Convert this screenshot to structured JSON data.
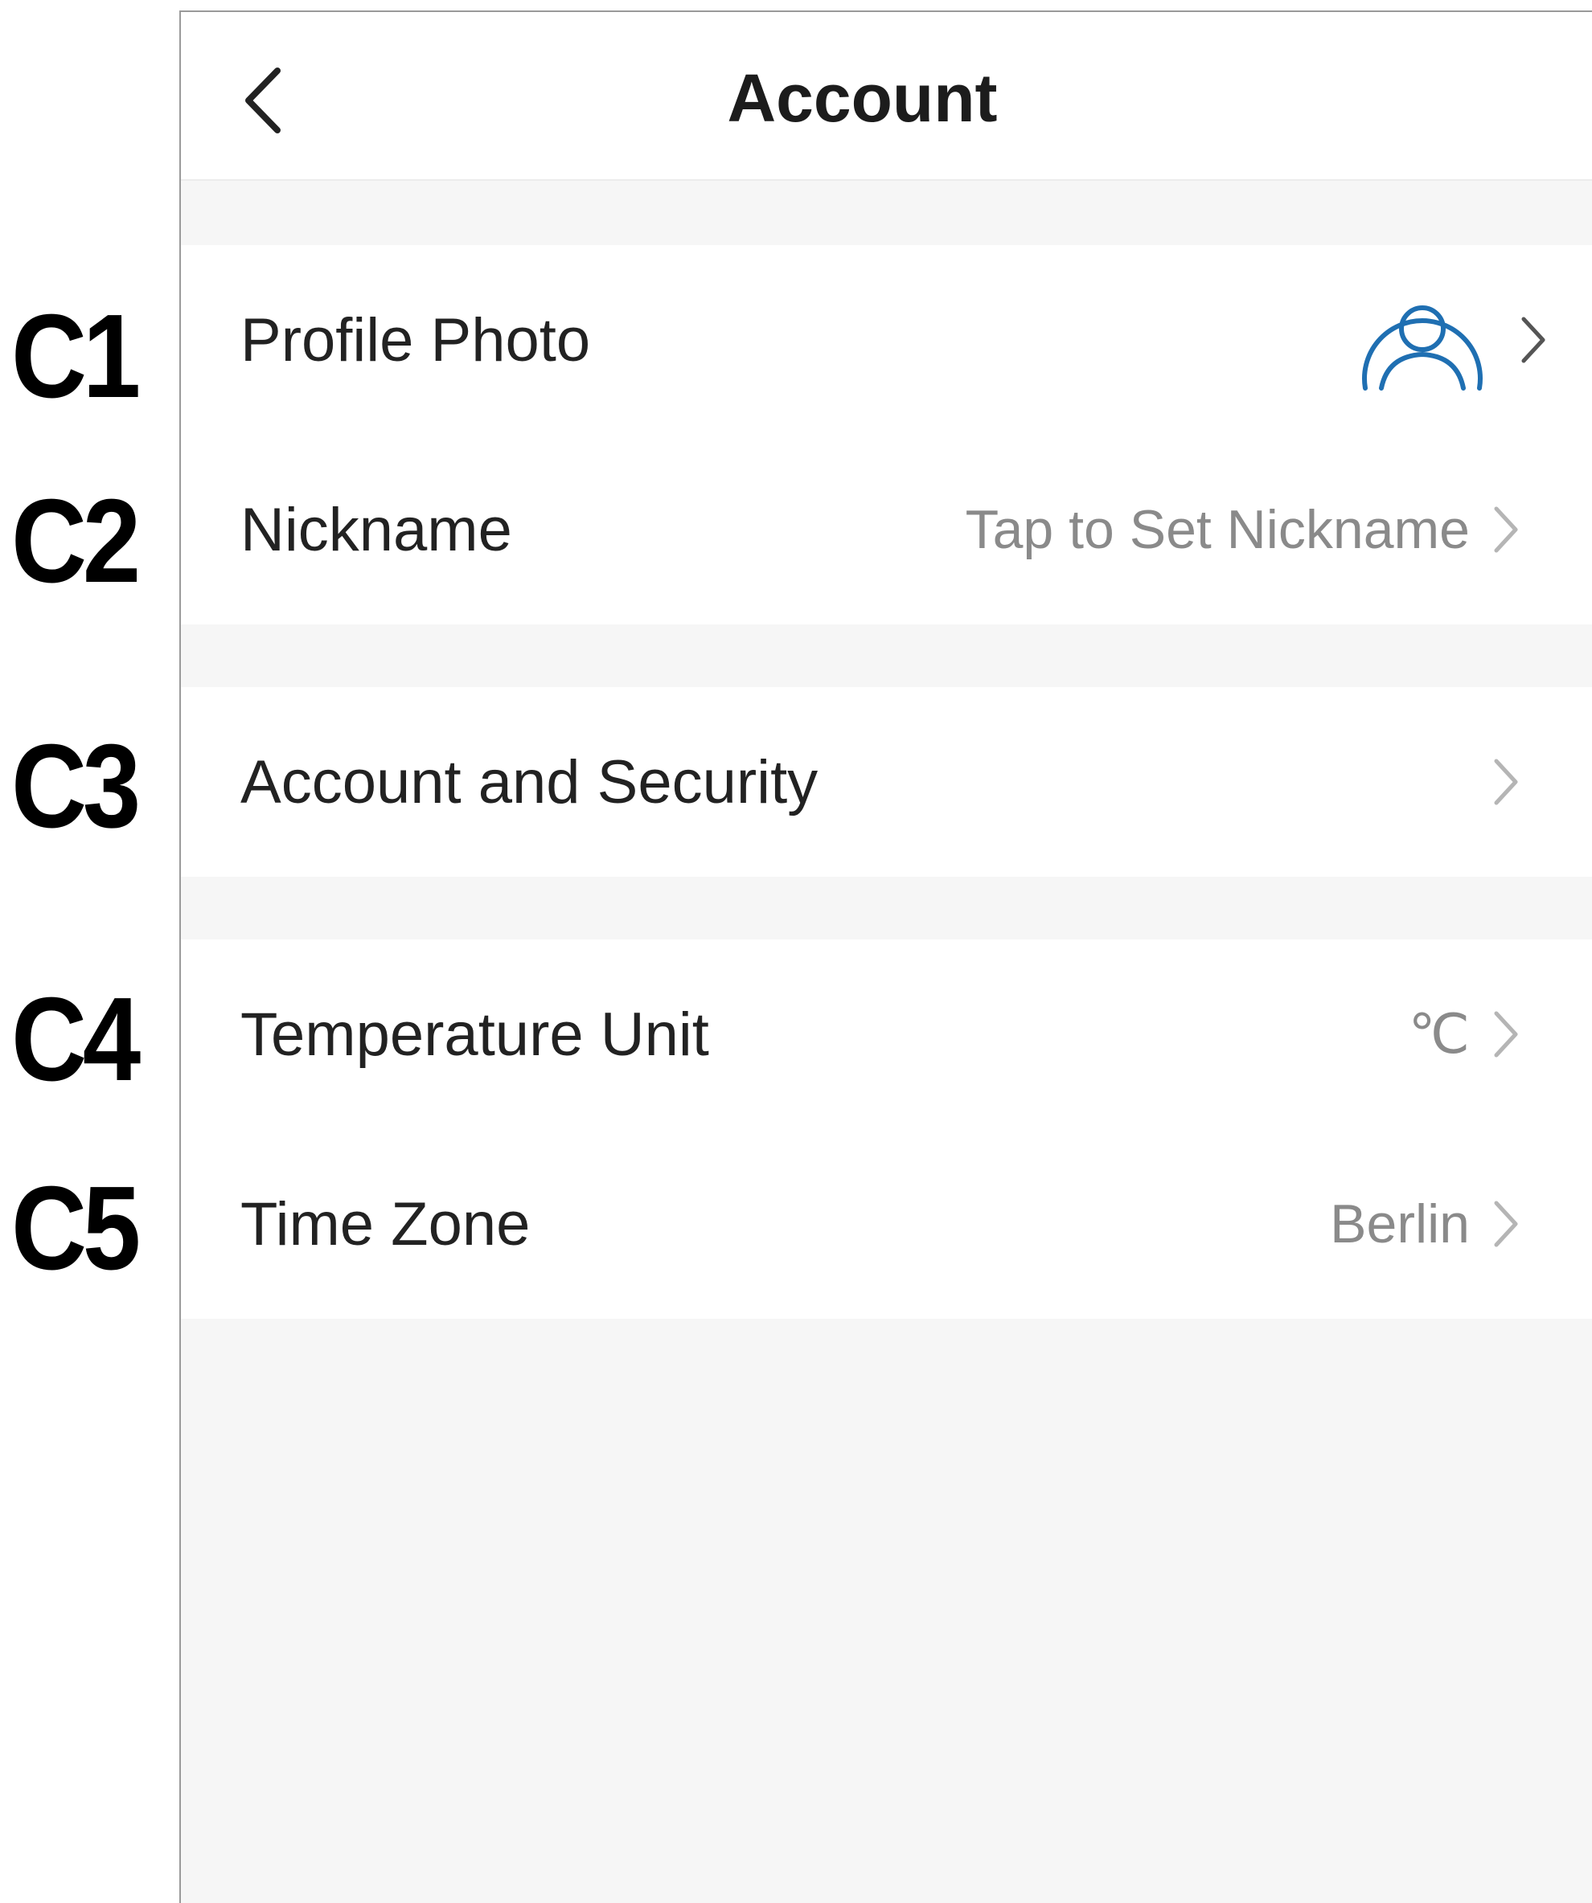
{
  "callouts": {
    "c1": "C1",
    "c2": "C2",
    "c3": "C3",
    "c4": "C4",
    "c5": "C5"
  },
  "header": {
    "title": "Account",
    "back_icon": "chevron-left-icon"
  },
  "rows": {
    "profile_photo": {
      "label": "Profile Photo",
      "icon": "user-avatar-icon",
      "accent": "#1f6fb2"
    },
    "nickname": {
      "label": "Nickname",
      "value": "Tap to Set Nickname"
    },
    "account_security": {
      "label": "Account and Security"
    },
    "temperature_unit": {
      "label": "Temperature Unit",
      "value": "℃"
    },
    "time_zone": {
      "label": "Time Zone",
      "value": "Berlin"
    }
  },
  "colors": {
    "background": "#f6f6f6",
    "row_background": "#ffffff",
    "label_text": "#222222",
    "value_text": "#8a8a8a",
    "chevron": "#b5b5b5"
  }
}
